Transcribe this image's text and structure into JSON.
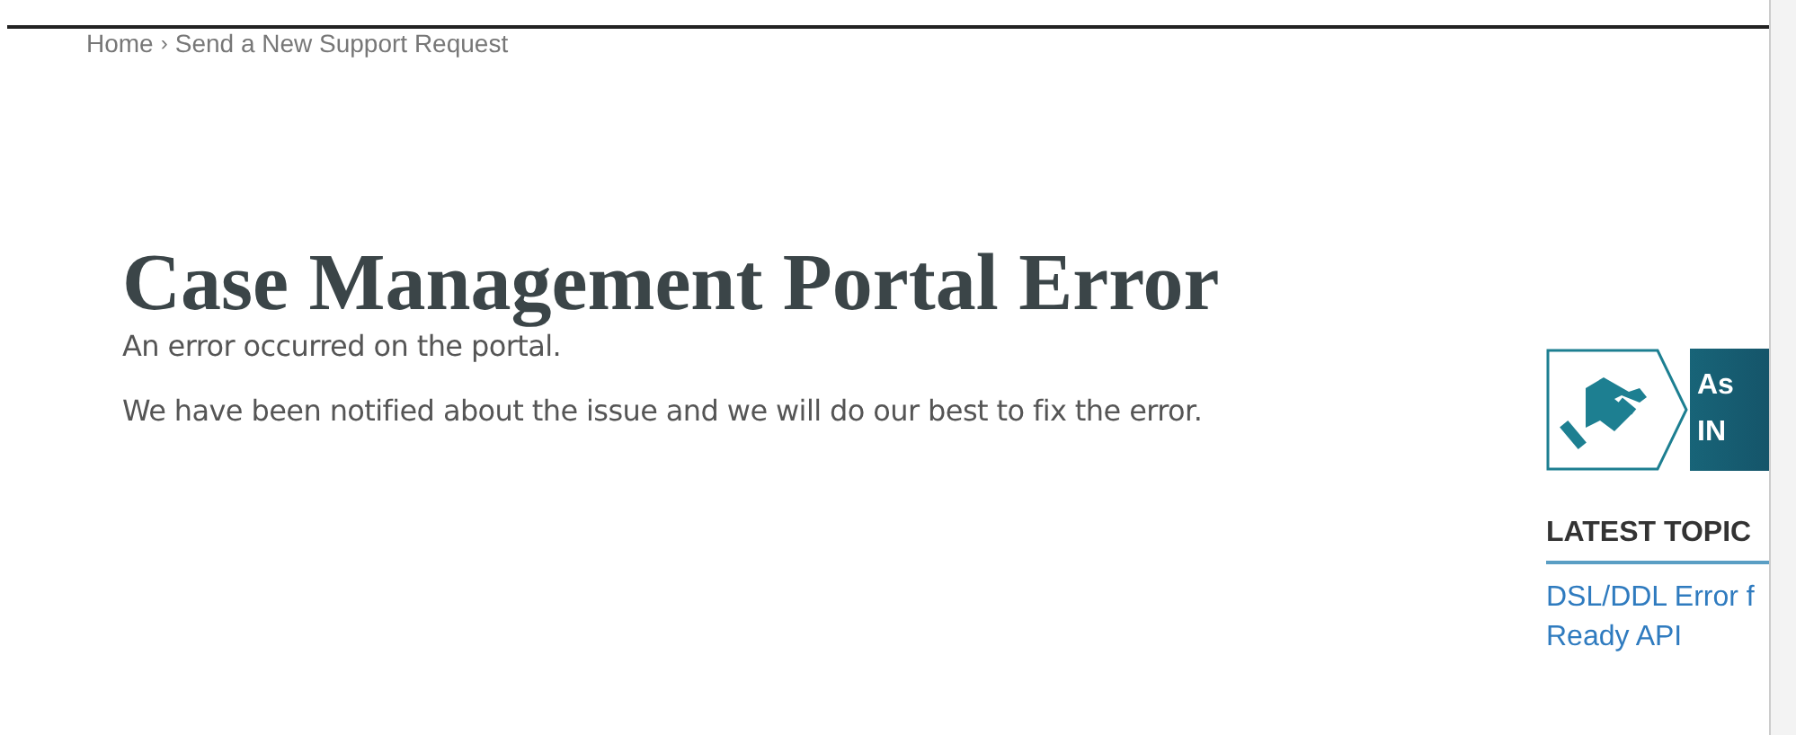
{
  "breadcrumb": {
    "items": [
      "Home",
      "Send a New Support Request"
    ],
    "separator": "›"
  },
  "title": "Case Management Portal Error",
  "paragraphs": [
    "An error occurred on the portal.",
    "We have been notified about the issue and we will do our best to fix the error."
  ],
  "sidebar": {
    "banner": {
      "lines": [
        "As",
        "IN"
      ]
    },
    "heading": "LATEST TOPIC",
    "links": [
      "DSL/DDL Error f",
      "Ready API"
    ]
  }
}
